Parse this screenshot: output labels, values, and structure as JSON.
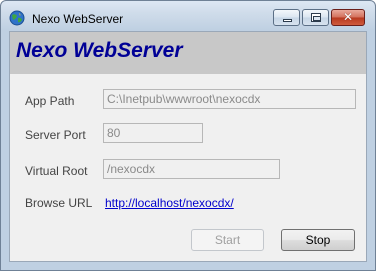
{
  "window": {
    "title": "Nexo WebServer"
  },
  "banner": {
    "title": "Nexo WebServer"
  },
  "form": {
    "app_path_label": "App Path",
    "app_path_value": "C:\\Inetpub\\wwwroot\\nexocdx",
    "server_port_label": "Server Port",
    "server_port_value": "80",
    "virtual_root_label": "Virtual Root",
    "virtual_root_value": "/nexocdx",
    "browse_url_label": "Browse URL",
    "browse_url_value": "http://localhost/nexocdx/"
  },
  "buttons": {
    "start_label": "Start",
    "stop_label": "Stop"
  },
  "colors": {
    "banner_title": "#000096",
    "banner_background": "#c8c8c8",
    "link": "#0000cc"
  },
  "icons": {
    "app": "globe-app-icon",
    "minimize": "minimize-icon",
    "maximize": "maximize-icon",
    "close": "close-icon"
  }
}
